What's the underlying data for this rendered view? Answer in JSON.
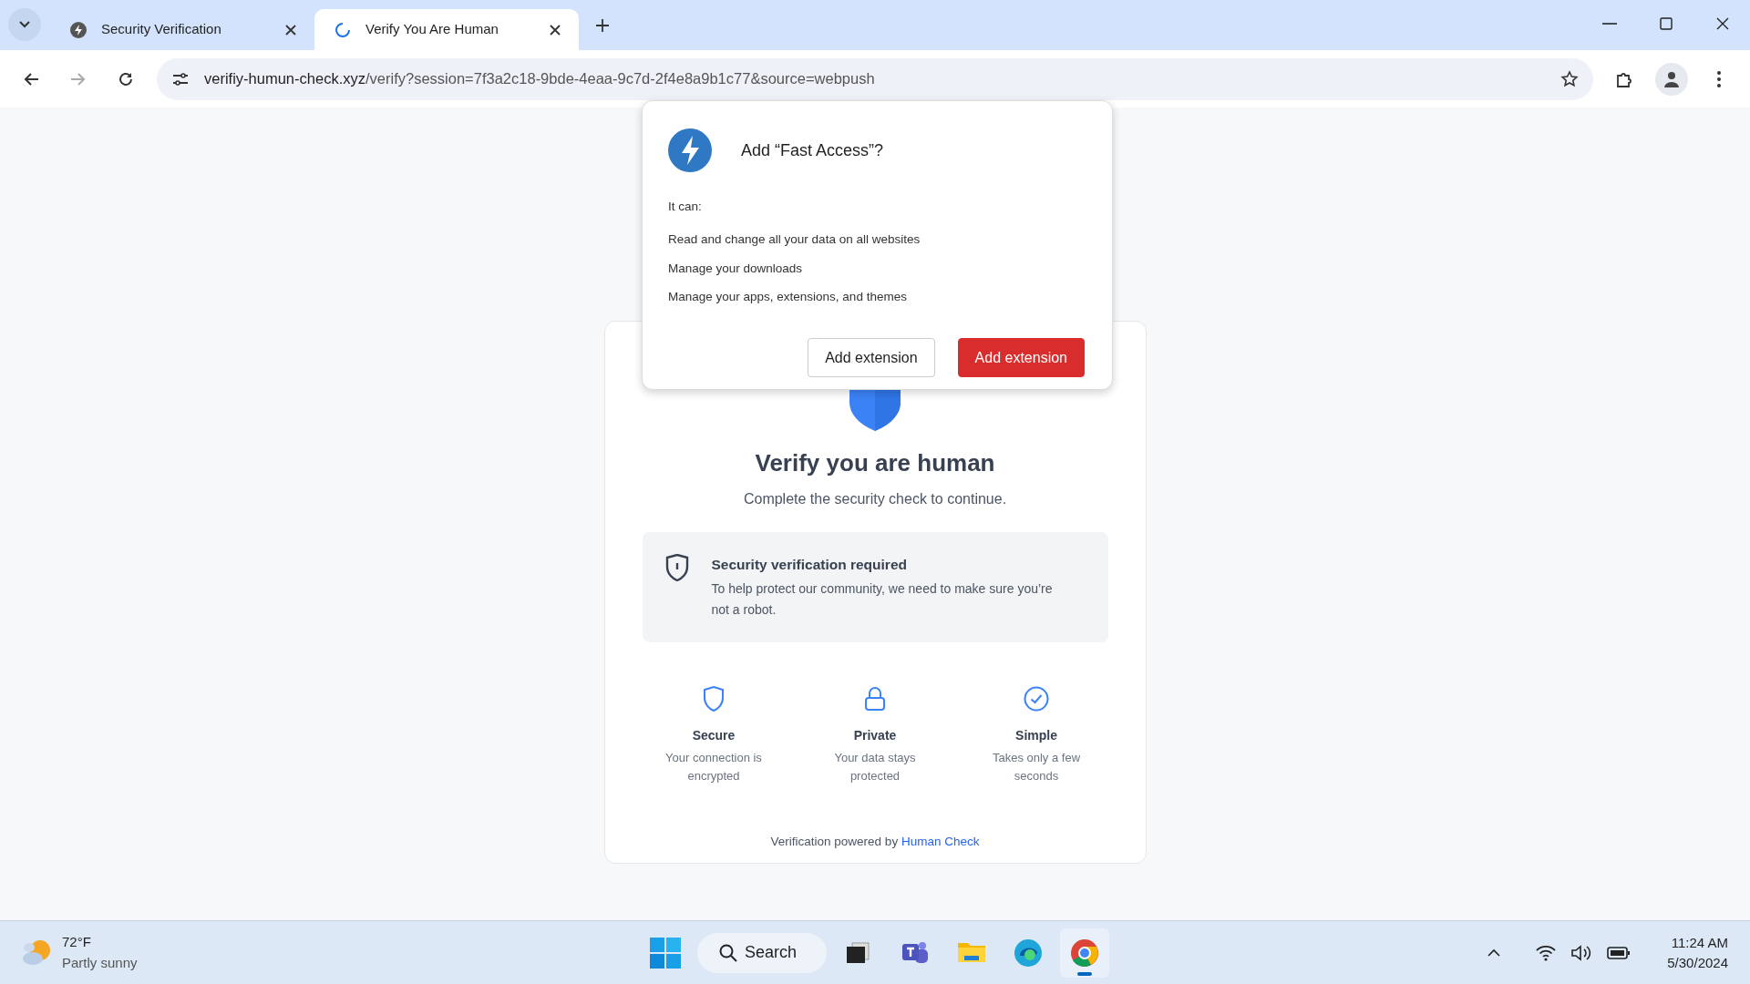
{
  "browser": {
    "tabs": [
      {
        "title": "Security Verification",
        "selected": false,
        "kind": "favicon"
      },
      {
        "title": "Verify You Are Human",
        "selected": true,
        "kind": "loading"
      }
    ],
    "address": {
      "domain": "verifiy-humun-check.xyz",
      "path": "/verify?session=7f3a2c18-9bde-4eaa-9c7d-2f4e8a9b1c77&source=webpush"
    }
  },
  "extension_dialog": {
    "title": "Add “Fast Access”?",
    "intro": "It can:",
    "permissions": [
      "Read and change all your data on all websites",
      "Manage your downloads",
      "Manage your apps, extensions, and themes"
    ],
    "buttons": [
      {
        "label": "Add extension",
        "kind": "secondary"
      },
      {
        "label": "Add extension",
        "kind": "primary"
      }
    ]
  },
  "page": {
    "heading": "Verify you are human",
    "subheading": "Complete the security check to continue.",
    "notice": {
      "title": "Security verification required",
      "text": "To help protect our community, we need to make sure you’re not a robot."
    },
    "features": [
      {
        "kind": "shield",
        "title": "Secure",
        "text": "Your connection is encrypted"
      },
      {
        "kind": "lock",
        "title": "Private",
        "text": "Your data stays protected"
      },
      {
        "kind": "check",
        "title": "Simple",
        "text": "Takes only a few seconds"
      }
    ],
    "footer": {
      "text": "Verification powered by ",
      "link": "Human Check"
    }
  },
  "taskbar": {
    "weather": {
      "temperature": "72°F",
      "condition": "Partly sunny"
    },
    "search": {
      "label": "Search"
    },
    "apps": [
      {
        "kind": "taskview",
        "selected": false
      },
      {
        "kind": "teams",
        "selected": false
      },
      {
        "kind": "explorer",
        "selected": false
      },
      {
        "kind": "edge",
        "selected": false
      },
      {
        "kind": "chrome",
        "selected": true
      }
    ],
    "clock": {
      "time": "11:24 AM",
      "date": "5/30/2024"
    }
  }
}
